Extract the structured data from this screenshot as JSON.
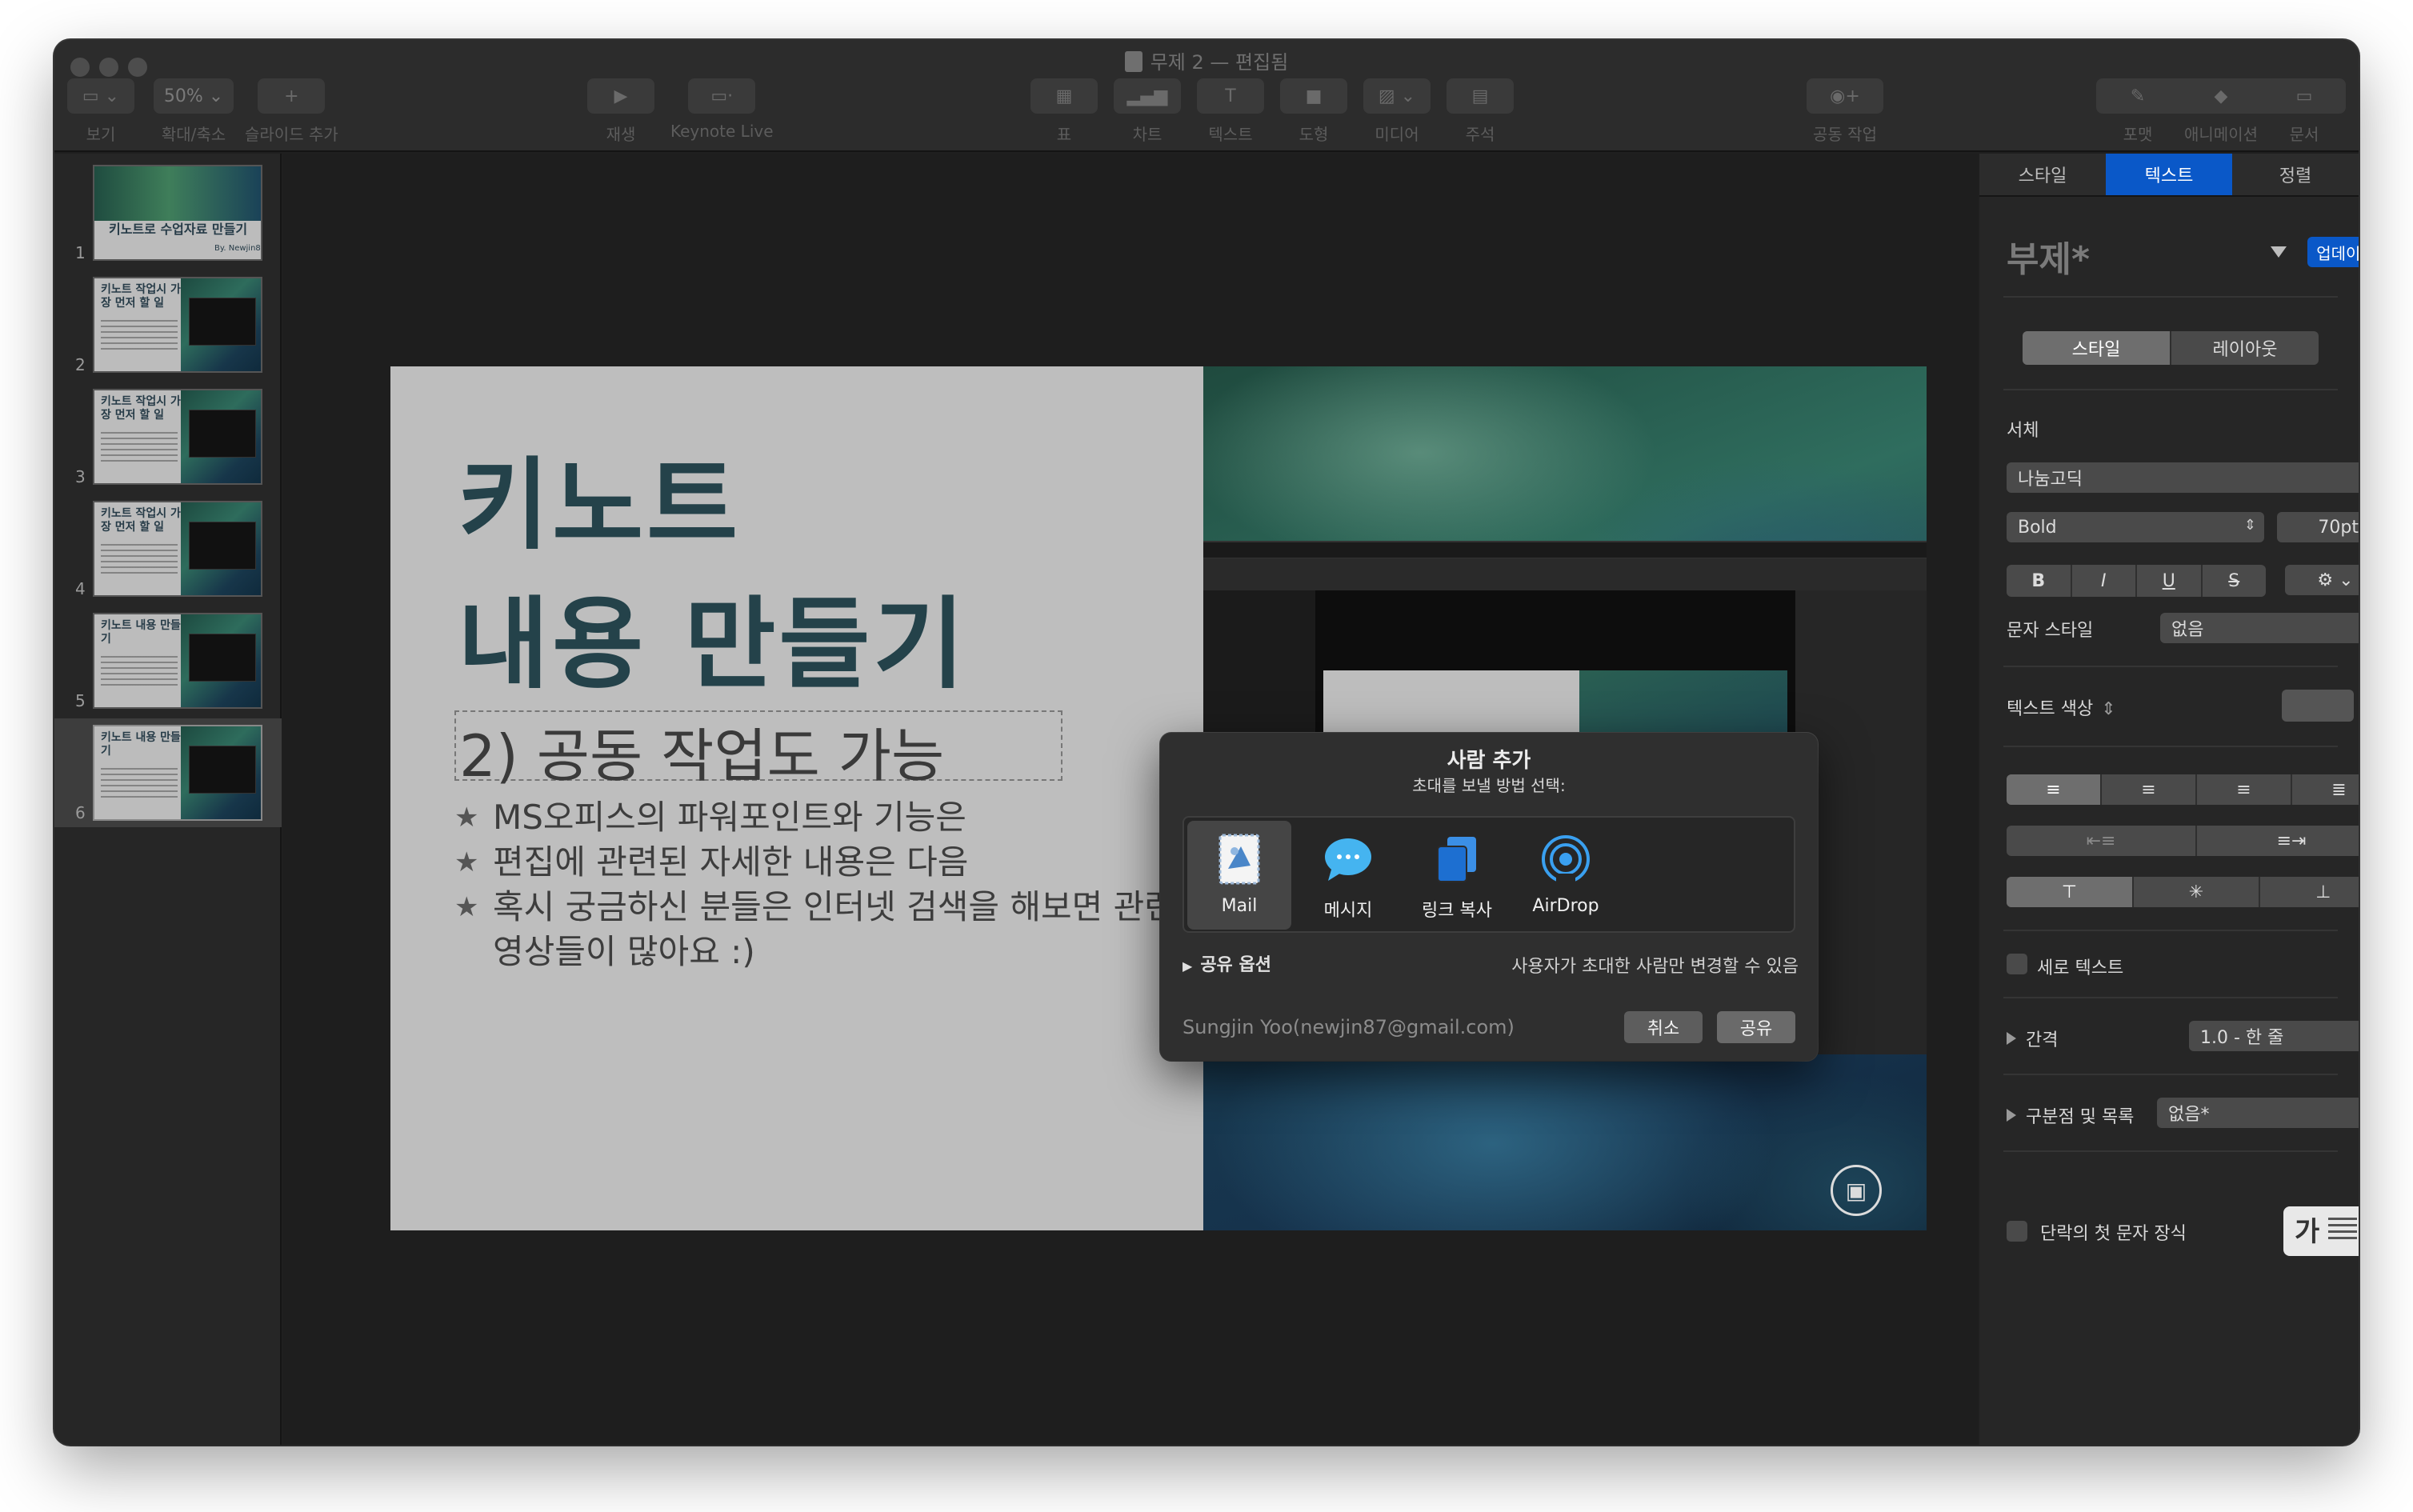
{
  "window": {
    "title": "무제 2 — 편집됨"
  },
  "toolbar": {
    "view_label": "보기",
    "zoom_value": "50%",
    "zoom_label": "확대/축소",
    "add_slide_label": "슬라이드 추가",
    "play_label": "재생",
    "keynote_live_label": "Keynote Live",
    "table_label": "표",
    "chart_label": "차트",
    "text_label": "텍스트",
    "shape_label": "도형",
    "media_label": "미디어",
    "comment_label": "주석",
    "collaborate_label": "공동 작업",
    "format_label": "포맷",
    "animate_label": "애니메이션",
    "document_label": "문서"
  },
  "navigator": {
    "slides": [
      {
        "num": "1",
        "title": "키노트로 수업자료 만들기",
        "byline": "By. Newjin87"
      },
      {
        "num": "2",
        "title": "키노트 작업시 가장 먼저 할 일"
      },
      {
        "num": "3",
        "title": "키노트 작업시 가장 먼저 할 일"
      },
      {
        "num": "4",
        "title": "키노트 작업시 가장 먼저 할 일"
      },
      {
        "num": "5",
        "title": "키노트 내용 만들기"
      },
      {
        "num": "6",
        "title": "키노트 내용 만들기"
      }
    ]
  },
  "slide": {
    "title_line1": "키노트",
    "title_line2": "내용 만들기",
    "subtitle": "2) 공동 작업도 가능",
    "bullets": [
      "MS오피스의 파워포인트와 기능은",
      "편집에 관련된 자세한 내용은 다음",
      "혹시 궁금하신 분들은 인터넷 검색을 해보면 관련",
      "영상들이 많아요 :)"
    ]
  },
  "share_dialog": {
    "title": "사람 추가",
    "subtitle": "초대를 보낼 방법 선택:",
    "methods": [
      {
        "label": "Mail",
        "icon": "mail-stamp-icon"
      },
      {
        "label": "메시지",
        "icon": "messages-bubble-icon"
      },
      {
        "label": "링크 복사",
        "icon": "copy-link-icon"
      },
      {
        "label": "AirDrop",
        "icon": "airdrop-icon"
      }
    ],
    "share_options_label": "공유 옵션",
    "permission_text": "사용자가 초대한 사람만 변경할 수 있음",
    "email": "Sungjin Yoo(newjin87@gmail.com)",
    "cancel_label": "취소",
    "share_label": "공유"
  },
  "inspector": {
    "tabs": [
      "스타일",
      "텍스트",
      "정렬"
    ],
    "active_tab": "텍스트",
    "paragraph_style": "부제*",
    "update_label": "업데이트",
    "segment": [
      "스타일",
      "레이아웃"
    ],
    "font_section_label": "서체",
    "font_family": "나눔고딕",
    "font_weight": "Bold",
    "font_size": "70pt",
    "format_buttons": [
      "B",
      "I",
      "U",
      "S"
    ],
    "char_style_label": "문자 스타일",
    "char_style_value": "없음",
    "text_color_label": "텍스트 색상",
    "vertical_text_label": "세로 텍스트",
    "spacing_label": "간격",
    "spacing_value": "1.0 - 한 줄",
    "bullets_label": "구분점 및 목록",
    "bullets_value": "없음*",
    "dropcap_label": "단락의 첫 문자 장식",
    "dropcap_char": "가"
  },
  "colors": {
    "accent": "#0a58c8",
    "slide_title": "#24424a",
    "window_bg": "#1f1f1f"
  }
}
